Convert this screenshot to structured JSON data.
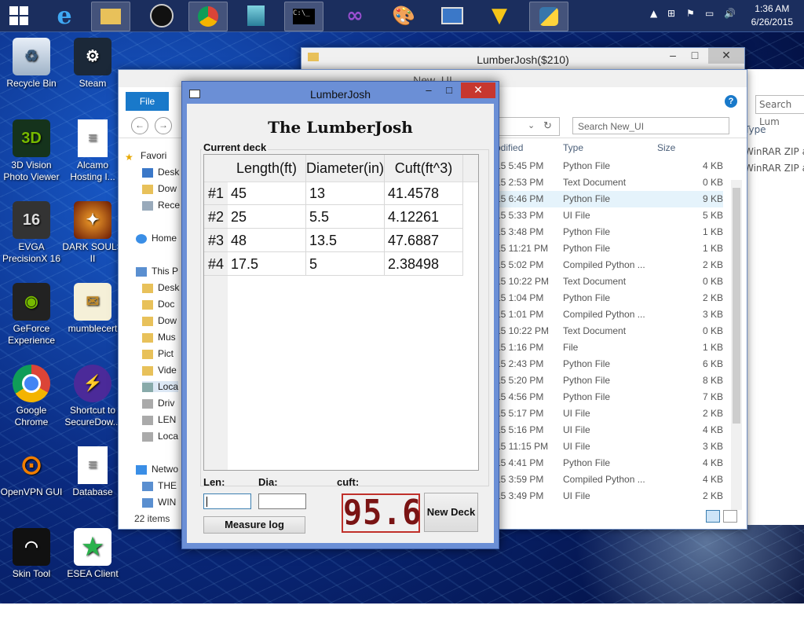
{
  "taskbar": {
    "clock_time": "1:36 AM",
    "clock_date": "6/26/2015"
  },
  "desktop_icons": [
    {
      "label": "Recycle Bin"
    },
    {
      "label": "Steam"
    },
    {
      "label": "3D Vision Photo Viewer"
    },
    {
      "label": "Alcamo Hosting I..."
    },
    {
      "label": "EVGA PrecisionX 16"
    },
    {
      "label": "DARK SOULS II"
    },
    {
      "label": "GeForce Experience"
    },
    {
      "label": "mumblecert"
    },
    {
      "label": "Google Chrome"
    },
    {
      "label": "Shortcut to SecureDow..."
    },
    {
      "label": "OpenVPN GUI"
    },
    {
      "label": "Database"
    },
    {
      "label": "Skin Tool"
    },
    {
      "label": "ESEA Client"
    }
  ],
  "explorer_back": {
    "title": "LumberJosh($210)",
    "search_placeholder": "Search Lum",
    "col_type": "Type",
    "rows": [
      "WinRAR ZIP ar",
      "WinRAR ZIP ar"
    ]
  },
  "explorer_front": {
    "title": "New_UI",
    "file_tab": "File",
    "search_placeholder": "Search New_UI",
    "nav_items": [
      "Favori",
      "Desk",
      "Dow",
      "Rece",
      "Home",
      "This P",
      "Desk",
      "Doc",
      "Dow",
      "Mus",
      "Pict",
      "Vide",
      "Loca",
      "Driv",
      "LEN",
      "Loca",
      "Netwo",
      "THE",
      "WIN"
    ],
    "item_count": "22 items",
    "columns": {
      "date": "odified",
      "type": "Type",
      "size": "Size"
    },
    "files": [
      {
        "date": "15 5:45 PM",
        "type": "Python File",
        "size": "4 KB"
      },
      {
        "date": "15 2:53 PM",
        "type": "Text Document",
        "size": "0 KB"
      },
      {
        "date": "15 6:46 PM",
        "type": "Python File",
        "size": "9 KB"
      },
      {
        "date": "15 5:33 PM",
        "type": "UI File",
        "size": "5 KB"
      },
      {
        "date": "15 3:48 PM",
        "type": "Python File",
        "size": "1 KB"
      },
      {
        "date": "15 11:21 PM",
        "type": "Python File",
        "size": "1 KB"
      },
      {
        "date": "15 5:02 PM",
        "type": "Compiled Python ...",
        "size": "2 KB"
      },
      {
        "date": "15 10:22 PM",
        "type": "Text Document",
        "size": "0 KB"
      },
      {
        "date": "15 1:04 PM",
        "type": "Python File",
        "size": "2 KB"
      },
      {
        "date": "15 1:01 PM",
        "type": "Compiled Python ...",
        "size": "3 KB"
      },
      {
        "date": "15 10:22 PM",
        "type": "Text Document",
        "size": "0 KB"
      },
      {
        "date": "15 1:16 PM",
        "type": "File",
        "size": "1 KB"
      },
      {
        "date": "15 2:43 PM",
        "type": "Python File",
        "size": "6 KB"
      },
      {
        "date": "15 5:20 PM",
        "type": "Python File",
        "size": "8 KB"
      },
      {
        "date": "15 4:56 PM",
        "type": "Python File",
        "size": "7 KB"
      },
      {
        "date": "15 5:17 PM",
        "type": "UI File",
        "size": "2 KB"
      },
      {
        "date": "15 5:16 PM",
        "type": "UI File",
        "size": "4 KB"
      },
      {
        "date": "15 11:15 PM",
        "type": "UI File",
        "size": "3 KB"
      },
      {
        "date": "15 4:41 PM",
        "type": "Python File",
        "size": "4 KB"
      },
      {
        "date": "15 3:59 PM",
        "type": "Compiled Python ...",
        "size": "4 KB"
      },
      {
        "date": "15 3:49 PM",
        "type": "UI File",
        "size": "2 KB"
      }
    ]
  },
  "lumberjosh": {
    "window_title": "LumberJosh",
    "header": "The LumberJosh",
    "group_title": "Current deck",
    "table": {
      "columns": [
        "Length(ft)",
        "Diameter(in)",
        "Cuft(ft^3)"
      ],
      "rows": [
        {
          "id": "#1",
          "length": "45",
          "diameter": "13",
          "cuft": "41.4578"
        },
        {
          "id": "#2",
          "length": "25",
          "diameter": "5.5",
          "cuft": "4.12261"
        },
        {
          "id": "#3",
          "length": "48",
          "diameter": "13.5",
          "cuft": "47.6887"
        },
        {
          "id": "#4",
          "length": "17.5",
          "diameter": "5",
          "cuft": "2.38498"
        }
      ]
    },
    "len_label": "Len:",
    "dia_label": "Dia:",
    "cuft_label": "cuft:",
    "len_value": "",
    "dia_value": "",
    "lcd_value": "95.65",
    "measure_button": "Measure log",
    "new_deck_button": "New Deck",
    "colors": {
      "accent_border": "#c0302a",
      "lcd_digits": "#7a1414",
      "frame": "#6b8fd6"
    }
  }
}
